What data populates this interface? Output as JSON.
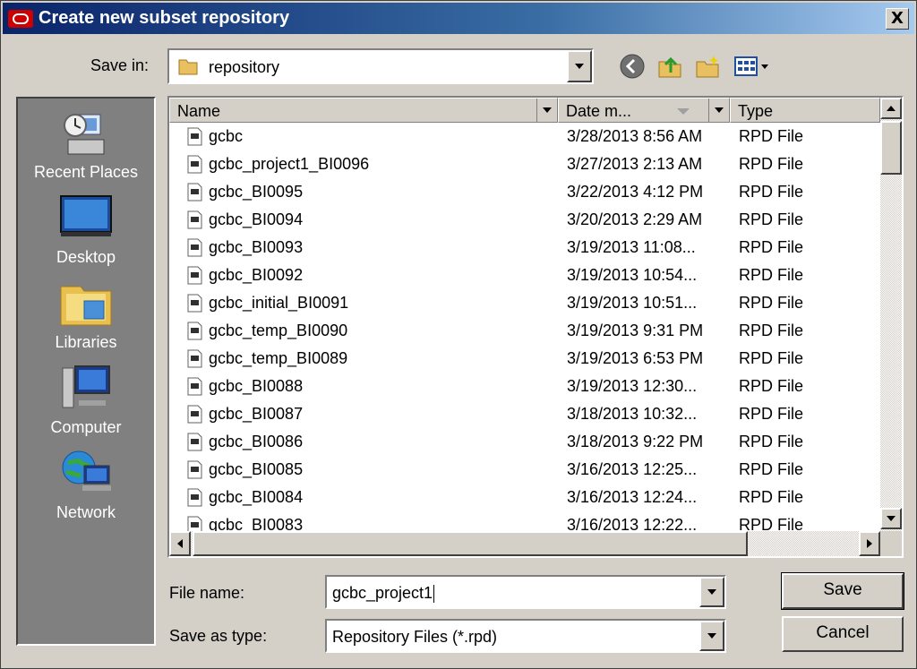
{
  "window": {
    "title": "Create new subset repository",
    "close_label": "X"
  },
  "toolbar": {
    "save_in_label": "Save in:",
    "save_in_value": "repository"
  },
  "places": [
    {
      "label": "Recent Places",
      "icon": "recent-places-icon"
    },
    {
      "label": "Desktop",
      "icon": "desktop-icon"
    },
    {
      "label": "Libraries",
      "icon": "libraries-icon"
    },
    {
      "label": "Computer",
      "icon": "computer-icon"
    },
    {
      "label": "Network",
      "icon": "network-icon"
    }
  ],
  "columns": {
    "name": "Name",
    "date": "Date m...",
    "type": "Type"
  },
  "files": [
    {
      "name": "gcbc",
      "date": "3/28/2013 8:56 AM",
      "type": "RPD File"
    },
    {
      "name": "gcbc_project1_BI0096",
      "date": "3/27/2013 2:13 AM",
      "type": "RPD File"
    },
    {
      "name": "gcbc_BI0095",
      "date": "3/22/2013 4:12 PM",
      "type": "RPD File"
    },
    {
      "name": "gcbc_BI0094",
      "date": "3/20/2013 2:29 AM",
      "type": "RPD File"
    },
    {
      "name": "gcbc_BI0093",
      "date": "3/19/2013 11:08...",
      "type": "RPD File"
    },
    {
      "name": "gcbc_BI0092",
      "date": "3/19/2013 10:54...",
      "type": "RPD File"
    },
    {
      "name": "gcbc_initial_BI0091",
      "date": "3/19/2013 10:51...",
      "type": "RPD File"
    },
    {
      "name": "gcbc_temp_BI0090",
      "date": "3/19/2013 9:31 PM",
      "type": "RPD File"
    },
    {
      "name": "gcbc_temp_BI0089",
      "date": "3/19/2013 6:53 PM",
      "type": "RPD File"
    },
    {
      "name": "gcbc_BI0088",
      "date": "3/19/2013 12:30...",
      "type": "RPD File"
    },
    {
      "name": "gcbc_BI0087",
      "date": "3/18/2013 10:32...",
      "type": "RPD File"
    },
    {
      "name": "gcbc_BI0086",
      "date": "3/18/2013 9:22 PM",
      "type": "RPD File"
    },
    {
      "name": "gcbc_BI0085",
      "date": "3/16/2013 12:25...",
      "type": "RPD File"
    },
    {
      "name": "gcbc_BI0084",
      "date": "3/16/2013 12:24...",
      "type": "RPD File"
    },
    {
      "name": "gcbc_BI0083",
      "date": "3/16/2013 12:22...",
      "type": "RPD File"
    }
  ],
  "form": {
    "file_name_label": "File name:",
    "file_name_value": "gcbc_project1",
    "save_type_label": "Save as type:",
    "save_type_value": "Repository Files (*.rpd)"
  },
  "buttons": {
    "save": "Save",
    "cancel": "Cancel"
  }
}
